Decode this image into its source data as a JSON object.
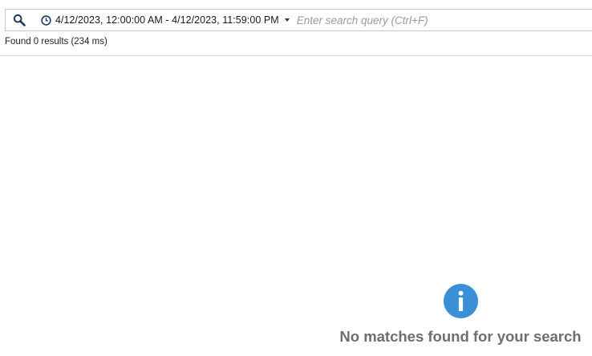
{
  "search": {
    "date_range": "4/12/2023, 12:00:00 AM - 4/12/2023, 11:59:00 PM",
    "query_value": "",
    "query_placeholder": "Enter search query (Ctrl+F)",
    "search_icon": "search-icon",
    "clock_icon": "clock-icon",
    "dropdown_icon": "caret-down-icon"
  },
  "results": {
    "status": "Found 0 results (234 ms)",
    "count": 0,
    "elapsed_ms": 234
  },
  "empty_state": {
    "icon": "info-icon",
    "message": "No matches found for your search"
  },
  "colors": {
    "accent": "#3a8fd6",
    "empty_text": "#6e6e6e",
    "border": "#c8c8c8"
  }
}
